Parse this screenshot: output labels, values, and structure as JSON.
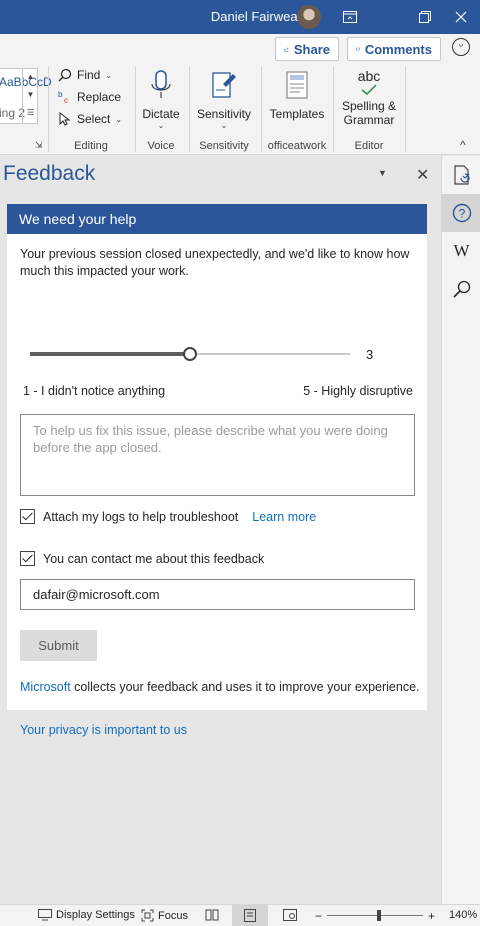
{
  "titlebar": {
    "user_name": "Daniel Fairweather",
    "bg_color": "#2b579a"
  },
  "ribbon": {
    "share_label": "Share",
    "comments_label": "Comments",
    "styles": {
      "item1": "AaBbCcD",
      "item2": "ing 2"
    },
    "editing": {
      "find_label": "Find",
      "replace_label": "Replace",
      "select_label": "Select",
      "group_label": "Editing"
    },
    "voice": {
      "dictate_label": "Dictate",
      "group_label": "Voice"
    },
    "sensitivity": {
      "button_label": "Sensitivity",
      "group_label": "Sensitivity"
    },
    "templates": {
      "button_label": "Templates",
      "group_label": "officeatwork"
    },
    "editor": {
      "icon_text": "abc",
      "button_line1": "Spelling &",
      "button_line2": "Grammar",
      "group_label": "Editor"
    }
  },
  "pane": {
    "title": "Feedback",
    "card_header": "We need your help",
    "intro_text": "Your previous session closed unexpectedly, and we'd like to know how much this impacted your work.",
    "slider": {
      "value": 3,
      "min": 1,
      "max": 5,
      "value_label": "3"
    },
    "scale_low_label": "1 - I didn't notice anything",
    "scale_high_label": "5 - Highly disruptive",
    "description_placeholder": "To help us fix this issue, please describe what you were doing before the app closed.",
    "attach_logs": {
      "label": "Attach my logs to help troubleshoot",
      "checked": true,
      "link": "Learn more"
    },
    "contact": {
      "label": "You can contact me about this feedback",
      "checked": true
    },
    "email_value": "dafair@microsoft.com",
    "submit_label": "Submit",
    "footnote_link": "Microsoft",
    "footnote_text": " collects your feedback and uses it to improve your experience.",
    "privacy_link": "Your privacy is important to us"
  },
  "rail": {
    "items": [
      "document-check-icon",
      "help-icon",
      "wikipedia-icon",
      "search-icon"
    ],
    "wiki_glyph": "W"
  },
  "statusbar": {
    "display_settings": "Display Settings",
    "focus": "Focus",
    "zoom_minus": "−",
    "zoom_plus": "+",
    "zoom_level": "140%"
  }
}
